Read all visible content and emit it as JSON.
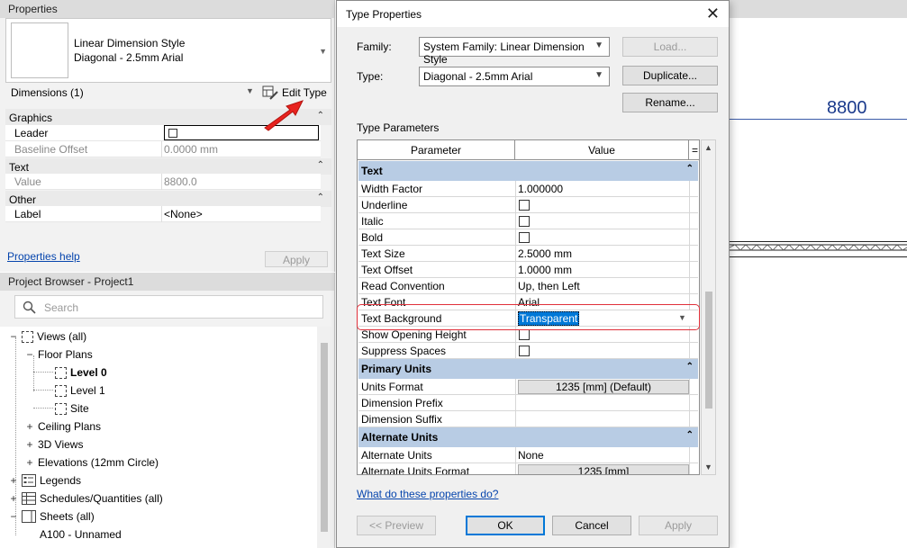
{
  "properties": {
    "title": "Properties",
    "type_line1": "Linear Dimension Style",
    "type_line2": "Diagonal - 2.5mm Arial",
    "instance_filter": "Dimensions (1)",
    "edit_type": "Edit Type",
    "groups": {
      "graphics": "Graphics",
      "text": "Text",
      "other": "Other"
    },
    "rows": {
      "leader": "Leader",
      "baseline_offset": "Baseline Offset",
      "baseline_offset_val": "0.0000 mm",
      "value": "Value",
      "value_val": "8800.0",
      "label": "Label",
      "label_val": "<None>"
    },
    "help": "Properties help",
    "apply": "Apply"
  },
  "browser": {
    "title": "Project Browser - Project1",
    "search_placeholder": "Search",
    "views": "Views (all)",
    "floor_plans": "Floor Plans",
    "level0": "Level 0",
    "level1": "Level 1",
    "site": "Site",
    "ceiling_plans": "Ceiling Plans",
    "views_3d": "3D Views",
    "elevations": "Elevations (12mm Circle)",
    "legends": "Legends",
    "schedules": "Schedules/Quantities (all)",
    "sheets": "Sheets (all)",
    "a100": "A100 - Unnamed"
  },
  "canvas": {
    "dimension_value": "8800"
  },
  "dialog": {
    "title": "Type Properties",
    "family_label": "Family:",
    "family_value": "System Family: Linear Dimension Style",
    "type_label": "Type:",
    "type_value": "Diagonal - 2.5mm Arial",
    "load": "Load...",
    "duplicate": "Duplicate...",
    "rename": "Rename...",
    "type_parameters": "Type Parameters",
    "col_parameter": "Parameter",
    "col_value": "Value",
    "col_eq": "=",
    "text_group": "Text",
    "width_factor": "Width Factor",
    "width_factor_val": "1.000000",
    "underline": "Underline",
    "italic": "Italic",
    "bold": "Bold",
    "text_size": "Text Size",
    "text_size_val": "2.5000 mm",
    "text_offset": "Text Offset",
    "text_offset_val": "1.0000 mm",
    "read_convention": "Read Convention",
    "read_convention_val": "Up, then Left",
    "text_font": "Text Font",
    "text_font_val": "Arial",
    "text_background": "Text Background",
    "text_background_val": "Transparent",
    "show_opening_height": "Show Opening Height",
    "suppress_spaces": "Suppress Spaces",
    "primary_units_group": "Primary Units",
    "units_format": "Units Format",
    "units_format_val": "1235 [mm] (Default)",
    "dimension_prefix": "Dimension Prefix",
    "dimension_suffix": "Dimension Suffix",
    "alternate_units_group": "Alternate Units",
    "alternate_units": "Alternate Units",
    "alternate_units_val": "None",
    "alternate_units_format": "Alternate Units Format",
    "alternate_units_format_val": "1235 [mm]",
    "help_link": "What do these properties do?",
    "preview": "<< Preview",
    "ok": "OK",
    "cancel": "Cancel",
    "apply": "Apply"
  }
}
